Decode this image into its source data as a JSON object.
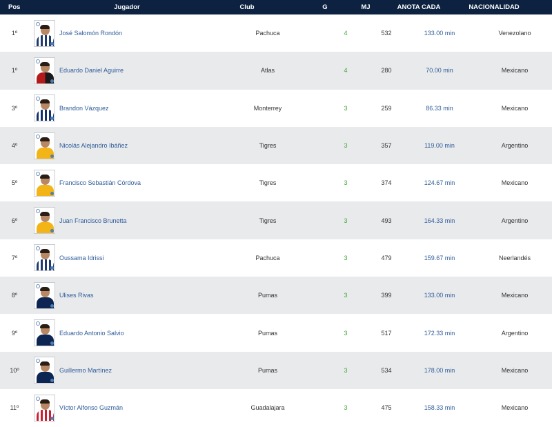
{
  "theme": {
    "header_bg": "#0c2240",
    "alt_row_bg": "#e9eaec",
    "link_color": "#2e5c99",
    "goals_color": "#3fa535"
  },
  "columns": {
    "pos": "Pos",
    "player": "Jugador",
    "club": "Club",
    "goals": "G",
    "games": "MJ",
    "scores_every": "ANOTA CADA",
    "nationality": "NACIONALIDAD"
  },
  "rows": [
    {
      "pos": "1º",
      "name": "José Salomón Rondón",
      "club": "Pachuca",
      "goals": "4",
      "games": "532",
      "every": "133.00 min",
      "nationality": "Venezolano",
      "kit": "pachuca"
    },
    {
      "pos": "1º",
      "name": "Eduardo Daniel Aguirre",
      "club": "Atlas",
      "goals": "4",
      "games": "280",
      "every": "70.00 min",
      "nationality": "Mexicano",
      "kit": "atlas"
    },
    {
      "pos": "3º",
      "name": "Brandon Vázquez",
      "club": "Monterrey",
      "goals": "3",
      "games": "259",
      "every": "86.33 min",
      "nationality": "Mexicano",
      "kit": "monterrey"
    },
    {
      "pos": "4º",
      "name": "Nicolás Alejandro Ibáñez",
      "club": "Tigres",
      "goals": "3",
      "games": "357",
      "every": "119.00 min",
      "nationality": "Argentino",
      "kit": "tigres"
    },
    {
      "pos": "5º",
      "name": "Francisco Sebastián Córdova",
      "club": "Tigres",
      "goals": "3",
      "games": "374",
      "every": "124.67 min",
      "nationality": "Mexicano",
      "kit": "tigres"
    },
    {
      "pos": "6º",
      "name": "Juan Francisco Brunetta",
      "club": "Tigres",
      "goals": "3",
      "games": "493",
      "every": "164.33 min",
      "nationality": "Argentino",
      "kit": "tigres"
    },
    {
      "pos": "7º",
      "name": "Oussama Idrissi",
      "club": "Pachuca",
      "goals": "3",
      "games": "479",
      "every": "159.67 min",
      "nationality": "Neerlandés",
      "kit": "pachuca"
    },
    {
      "pos": "8º",
      "name": "Ulises Rivas",
      "club": "Pumas",
      "goals": "3",
      "games": "399",
      "every": "133.00 min",
      "nationality": "Mexicano",
      "kit": "pumas"
    },
    {
      "pos": "9º",
      "name": "Eduardo Antonio Salvio",
      "club": "Pumas",
      "goals": "3",
      "games": "517",
      "every": "172.33 min",
      "nationality": "Argentino",
      "kit": "pumas"
    },
    {
      "pos": "10º",
      "name": "Guillermo Martínez",
      "club": "Pumas",
      "goals": "3",
      "games": "534",
      "every": "178.00 min",
      "nationality": "Mexicano",
      "kit": "pumas"
    },
    {
      "pos": "11º",
      "name": "Víctor Alfonso Guzmán",
      "club": "Guadalajara",
      "goals": "3",
      "games": "475",
      "every": "158.33 min",
      "nationality": "Mexicano",
      "kit": "guadalajara"
    }
  ]
}
